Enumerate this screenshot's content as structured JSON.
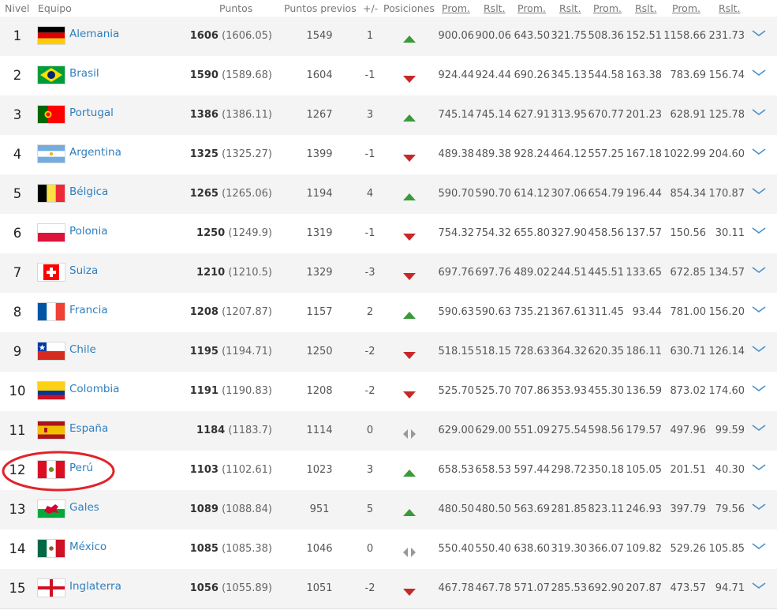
{
  "colors": {
    "link": "#2f7fbf",
    "up": "#3a9a3a",
    "down": "#c62828",
    "same": "#999999",
    "highlight": "#e0242a"
  },
  "header": {
    "nivel": "Nivel",
    "equipo": "Equipo",
    "puntos": "Puntos",
    "previos": "Puntos previos",
    "cambio": "+/-",
    "posiciones": "Posiciones",
    "cols": [
      "Prom.",
      "Rslt.",
      "Prom.",
      "Rslt.",
      "Prom.",
      "Rslt.",
      "Prom.",
      "Rslt."
    ]
  },
  "rows": [
    {
      "rank": "1",
      "team": "Alemania",
      "flag": "germany",
      "pts": "1606",
      "pts_exact": "(1606.05)",
      "prev": "1549",
      "chg": "1",
      "trend": "up",
      "vals": [
        "900.06",
        "900.06",
        "643.50",
        "321.75",
        "508.36",
        "152.51",
        "1158.66",
        "231.73"
      ]
    },
    {
      "rank": "2",
      "team": "Brasil",
      "flag": "brazil",
      "pts": "1590",
      "pts_exact": "(1589.68)",
      "prev": "1604",
      "chg": "-1",
      "trend": "down",
      "vals": [
        "924.44",
        "924.44",
        "690.26",
        "345.13",
        "544.58",
        "163.38",
        "783.69",
        "156.74"
      ]
    },
    {
      "rank": "3",
      "team": "Portugal",
      "flag": "portugal",
      "pts": "1386",
      "pts_exact": "(1386.11)",
      "prev": "1267",
      "chg": "3",
      "trend": "up",
      "vals": [
        "745.14",
        "745.14",
        "627.91",
        "313.95",
        "670.77",
        "201.23",
        "628.91",
        "125.78"
      ]
    },
    {
      "rank": "4",
      "team": "Argentina",
      "flag": "argentina",
      "pts": "1325",
      "pts_exact": "(1325.27)",
      "prev": "1399",
      "chg": "-1",
      "trend": "down",
      "vals": [
        "489.38",
        "489.38",
        "928.24",
        "464.12",
        "557.25",
        "167.18",
        "1022.99",
        "204.60"
      ]
    },
    {
      "rank": "5",
      "team": "Bélgica",
      "flag": "belgium",
      "pts": "1265",
      "pts_exact": "(1265.06)",
      "prev": "1194",
      "chg": "4",
      "trend": "up",
      "vals": [
        "590.70",
        "590.70",
        "614.12",
        "307.06",
        "654.79",
        "196.44",
        "854.34",
        "170.87"
      ]
    },
    {
      "rank": "6",
      "team": "Polonia",
      "flag": "poland",
      "pts": "1250",
      "pts_exact": "(1249.9)",
      "prev": "1319",
      "chg": "-1",
      "trend": "down",
      "vals": [
        "754.32",
        "754.32",
        "655.80",
        "327.90",
        "458.56",
        "137.57",
        "150.56",
        "30.11"
      ]
    },
    {
      "rank": "7",
      "team": "Suiza",
      "flag": "switzerland",
      "pts": "1210",
      "pts_exact": "(1210.5)",
      "prev": "1329",
      "chg": "-3",
      "trend": "down",
      "vals": [
        "697.76",
        "697.76",
        "489.02",
        "244.51",
        "445.51",
        "133.65",
        "672.85",
        "134.57"
      ]
    },
    {
      "rank": "8",
      "team": "Francia",
      "flag": "france",
      "pts": "1208",
      "pts_exact": "(1207.87)",
      "prev": "1157",
      "chg": "2",
      "trend": "up",
      "vals": [
        "590.63",
        "590.63",
        "735.21",
        "367.61",
        "311.45",
        "93.44",
        "781.00",
        "156.20"
      ]
    },
    {
      "rank": "9",
      "team": "Chile",
      "flag": "chile",
      "pts": "1195",
      "pts_exact": "(1194.71)",
      "prev": "1250",
      "chg": "-2",
      "trend": "down",
      "vals": [
        "518.15",
        "518.15",
        "728.63",
        "364.32",
        "620.35",
        "186.11",
        "630.71",
        "126.14"
      ]
    },
    {
      "rank": "10",
      "team": "Colombia",
      "flag": "colombia",
      "pts": "1191",
      "pts_exact": "(1190.83)",
      "prev": "1208",
      "chg": "-2",
      "trend": "down",
      "vals": [
        "525.70",
        "525.70",
        "707.86",
        "353.93",
        "455.30",
        "136.59",
        "873.02",
        "174.60"
      ]
    },
    {
      "rank": "11",
      "team": "España",
      "flag": "spain",
      "pts": "1184",
      "pts_exact": "(1183.7)",
      "prev": "1114",
      "chg": "0",
      "trend": "same",
      "vals": [
        "629.00",
        "629.00",
        "551.09",
        "275.54",
        "598.56",
        "179.57",
        "497.96",
        "99.59"
      ]
    },
    {
      "rank": "12",
      "team": "Perú",
      "flag": "peru",
      "pts": "1103",
      "pts_exact": "(1102.61)",
      "prev": "1023",
      "chg": "3",
      "trend": "up",
      "vals": [
        "658.53",
        "658.53",
        "597.44",
        "298.72",
        "350.18",
        "105.05",
        "201.51",
        "40.30"
      ]
    },
    {
      "rank": "13",
      "team": "Gales",
      "flag": "wales",
      "pts": "1089",
      "pts_exact": "(1088.84)",
      "prev": "951",
      "chg": "5",
      "trend": "up",
      "vals": [
        "480.50",
        "480.50",
        "563.69",
        "281.85",
        "823.11",
        "246.93",
        "397.79",
        "79.56"
      ]
    },
    {
      "rank": "14",
      "team": "México",
      "flag": "mexico",
      "pts": "1085",
      "pts_exact": "(1085.38)",
      "prev": "1046",
      "chg": "0",
      "trend": "same",
      "vals": [
        "550.40",
        "550.40",
        "638.60",
        "319.30",
        "366.07",
        "109.82",
        "529.26",
        "105.85"
      ]
    },
    {
      "rank": "15",
      "team": "Inglaterra",
      "flag": "england",
      "pts": "1056",
      "pts_exact": "(1055.89)",
      "prev": "1051",
      "chg": "-2",
      "trend": "down",
      "vals": [
        "467.78",
        "467.78",
        "571.07",
        "285.53",
        "692.90",
        "207.87",
        "473.57",
        "94.71"
      ]
    }
  ]
}
